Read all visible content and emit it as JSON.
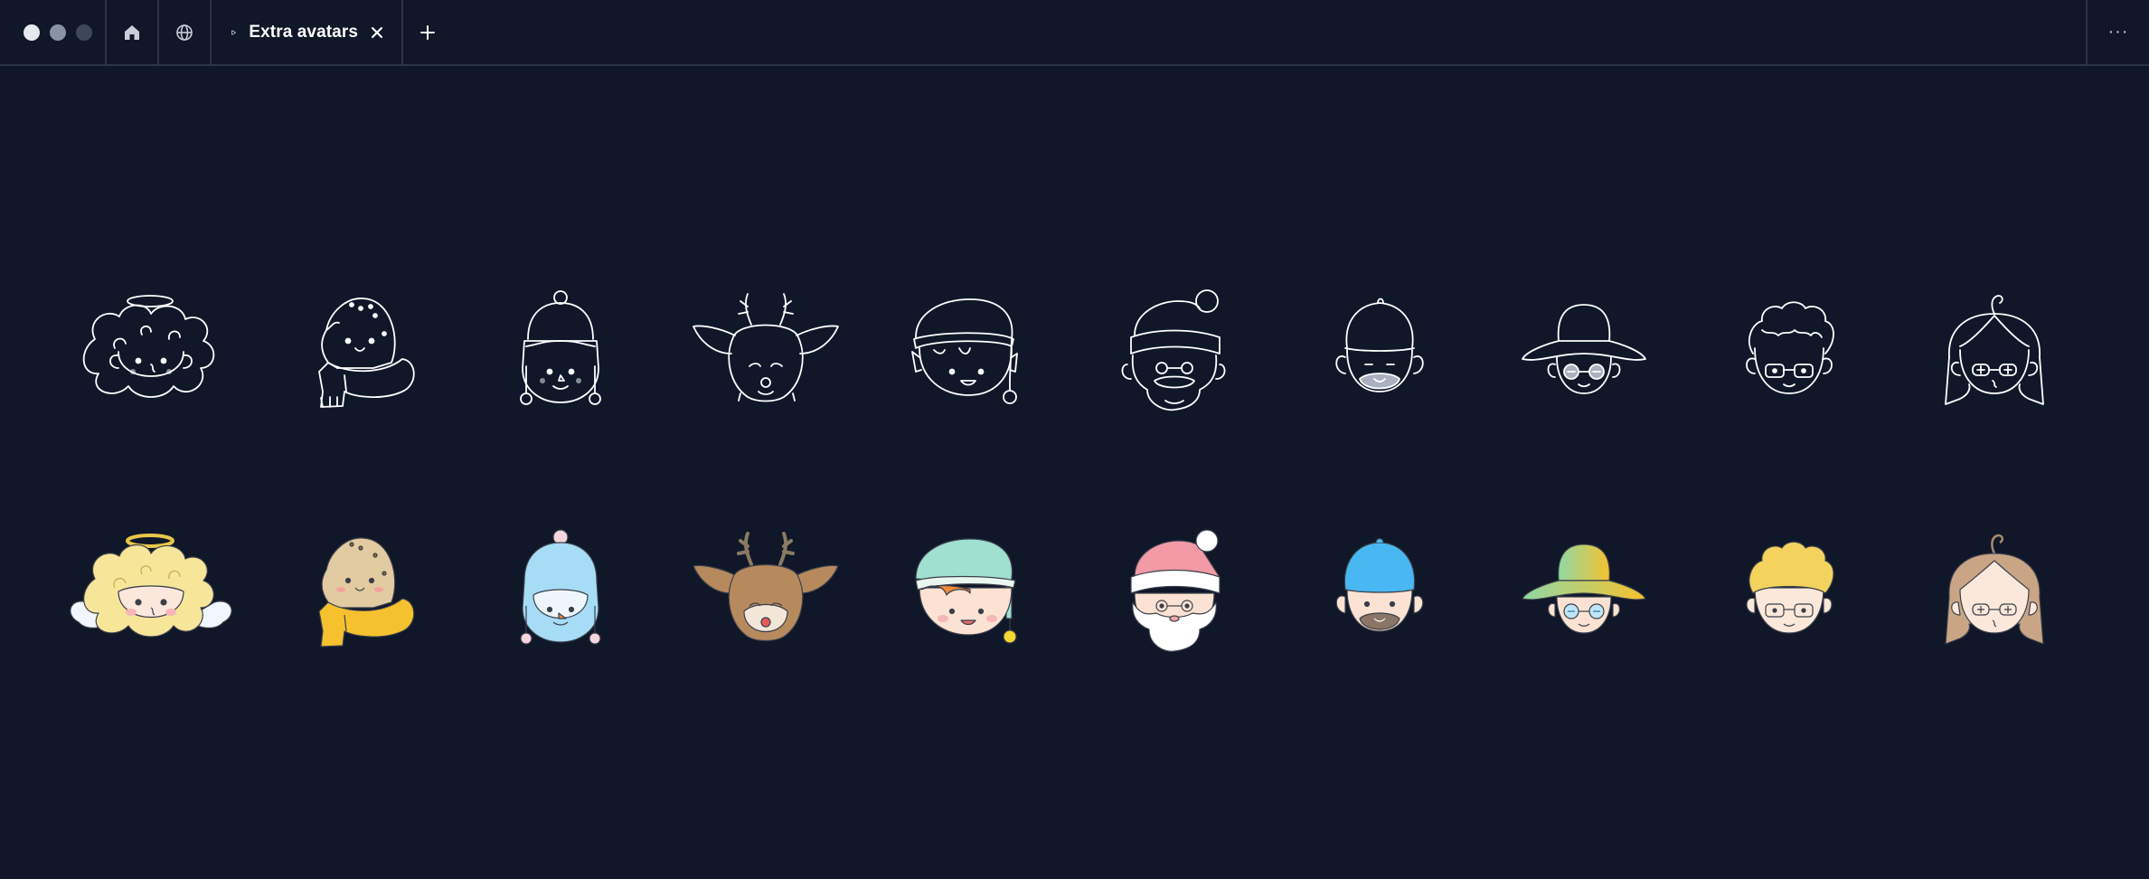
{
  "window": {
    "controls": [
      "close",
      "minimize",
      "maximize"
    ]
  },
  "toolbar": {
    "home_icon": "home-icon",
    "globe_icon": "globe-icon",
    "tab": {
      "label": "Extra avatars",
      "icon": "play-icon",
      "close_icon": "close-icon"
    },
    "new_tab_icon": "plus-icon",
    "more_icon": "more-icon",
    "more_glyph": "···"
  },
  "avatars": {
    "outline_row": [
      "angel",
      "cookie",
      "snowman",
      "reindeer",
      "elf",
      "santa",
      "cap-boy",
      "bucket-hat-boy",
      "curly-boy",
      "girl"
    ],
    "color_row": [
      "angel",
      "cookie",
      "snowman",
      "reindeer",
      "elf",
      "santa",
      "cap-boy",
      "bucket-hat-boy",
      "curly-boy",
      "girl"
    ]
  },
  "colors": {
    "background": "#101728",
    "line": "#ffffff",
    "divider": "#2b3448"
  }
}
